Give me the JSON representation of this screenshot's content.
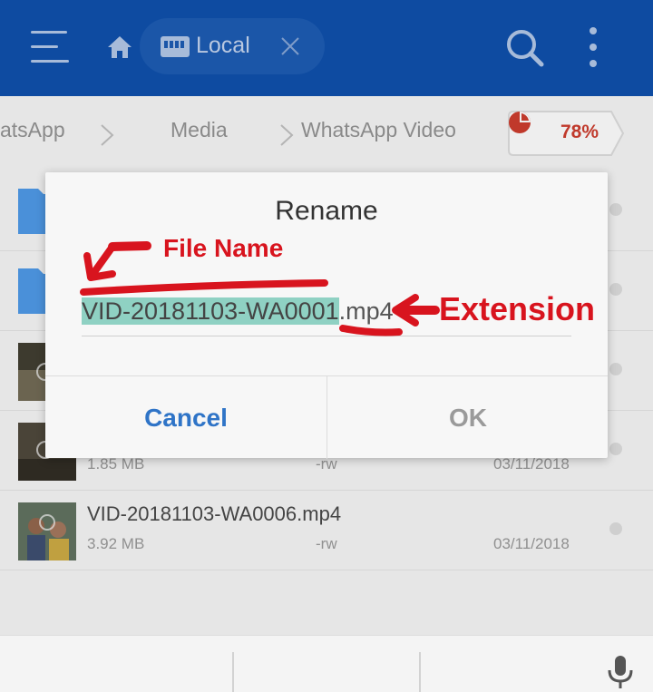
{
  "appbar": {
    "location_chip": {
      "label": "Local"
    },
    "icons": [
      "menu-icon",
      "home-icon",
      "sd-card-icon",
      "close-icon",
      "search-icon",
      "more-vert-icon"
    ]
  },
  "breadcrumb": {
    "items": [
      "atsApp",
      "Media",
      "WhatsApp Video"
    ],
    "storage_percent": "78%"
  },
  "files": [
    {
      "name": "VID-20181103-WA0006.mp4",
      "size": "3.92 MB",
      "permissions": "-rw",
      "date": "03/11/2018"
    }
  ],
  "partial_row": {
    "size": "1.85 MB",
    "permissions": "-rw",
    "date": "03/11/2018"
  },
  "dialog": {
    "title": "Rename",
    "filename_base": "VID-20181103-WA0001",
    "filename_ext": ".mp4",
    "cancel_label": "Cancel",
    "ok_label": "OK"
  },
  "annotations": {
    "file_name": "File Name",
    "extension": "Extension",
    "color": "#d8141e"
  },
  "colors": {
    "appbar": "#0e4ba1",
    "accent": "#2f74c7",
    "selection": "#8fd1c3"
  }
}
